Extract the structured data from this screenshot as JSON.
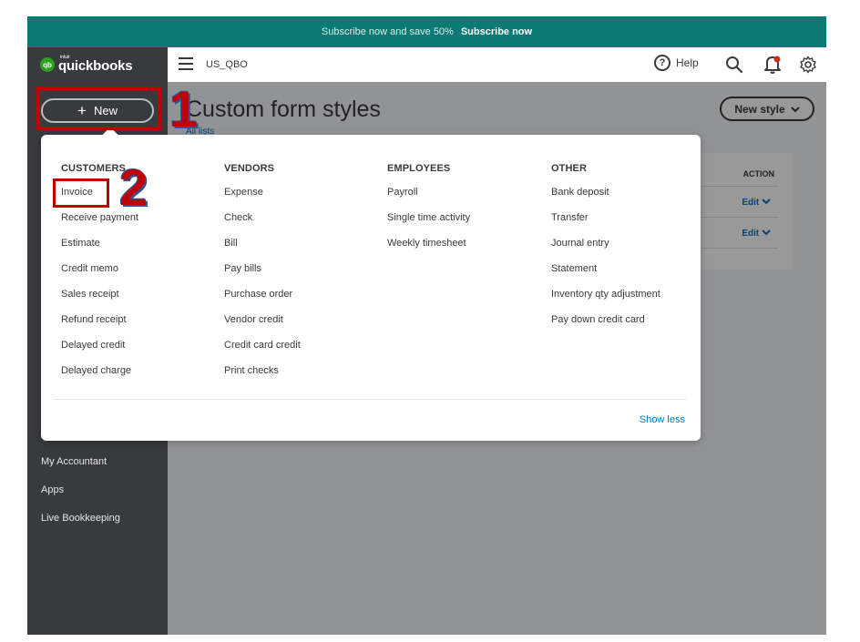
{
  "promo": {
    "text": "Subscribe now and save 50%",
    "cta": "Subscribe now"
  },
  "header": {
    "logo_small": "intuit",
    "logo_text": "quickbooks",
    "logo_badge": "qb",
    "company": "US_QBO",
    "help_label": "Help",
    "help_glyph": "?"
  },
  "sidebar": {
    "new_label": "New",
    "items": [
      {
        "label": "My Accountant"
      },
      {
        "label": "Apps"
      },
      {
        "label": "Live Bookkeeping"
      }
    ]
  },
  "main": {
    "title": "Custom form styles",
    "back_link": "All lists",
    "new_style_label": "New style",
    "table": {
      "action_header": "ACTION",
      "edit_label": "Edit"
    }
  },
  "menu": {
    "columns": [
      {
        "heading": "CUSTOMERS",
        "items": [
          "Invoice",
          "Receive payment",
          "Estimate",
          "Credit memo",
          "Sales receipt",
          "Refund receipt",
          "Delayed credit",
          "Delayed charge"
        ]
      },
      {
        "heading": "VENDORS",
        "items": [
          "Expense",
          "Check",
          "Bill",
          "Pay bills",
          "Purchase order",
          "Vendor credit",
          "Credit card credit",
          "Print checks"
        ]
      },
      {
        "heading": "EMPLOYEES",
        "items": [
          "Payroll",
          "Single time activity",
          "Weekly timesheet"
        ]
      },
      {
        "heading": "OTHER",
        "items": [
          "Bank deposit",
          "Transfer",
          "Journal entry",
          "Statement",
          "Inventory qty adjustment",
          "Pay down credit card"
        ]
      }
    ],
    "show_less": "Show less"
  },
  "annotations": {
    "step1": "1",
    "step2": "2"
  },
  "colors": {
    "brand_teal": "#0b7a75",
    "sidebar": "#393a3d",
    "link_blue": "#0077c5",
    "annotation_red": "#c00000"
  }
}
